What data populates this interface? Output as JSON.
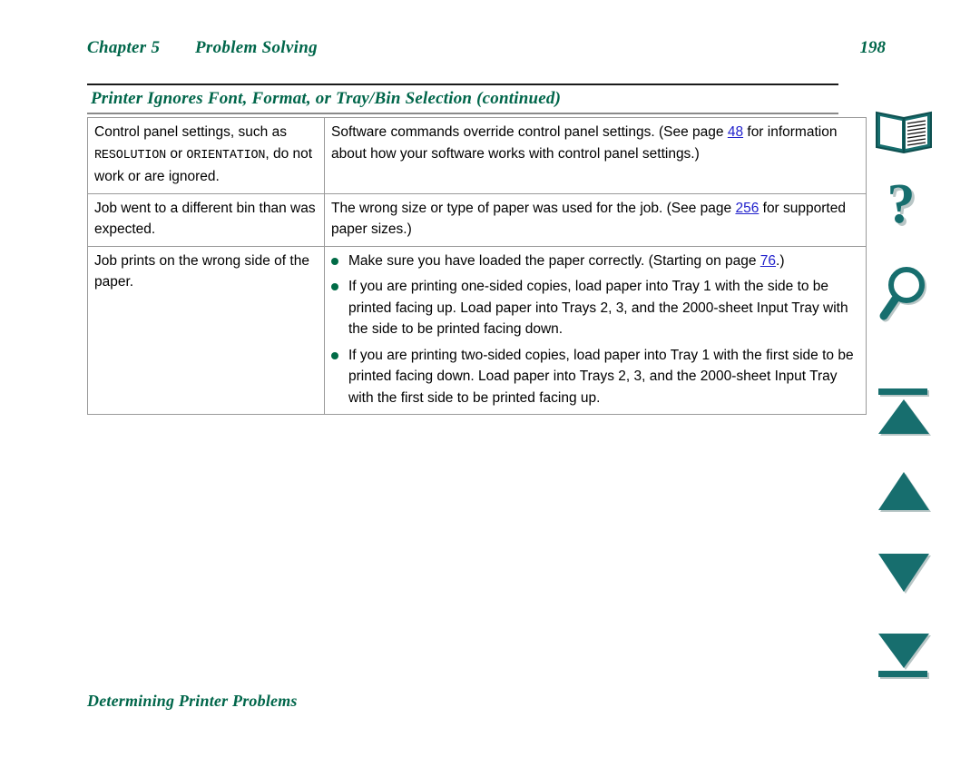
{
  "header": {
    "chapter": "Chapter 5",
    "section": "Problem Solving",
    "page_number": "198",
    "heading_color": "#00664a"
  },
  "table": {
    "title": "Printer Ignores Font, Format, or Tray/Bin Selection (continued)",
    "rows": [
      {
        "cause_prefix": "Control panel settings, such as ",
        "cause_mono_1": "RESOLUTION",
        "cause_mid": " or ",
        "cause_mono_2": "ORIENTATION",
        "cause_suffix": ", do not work or are ignored.",
        "solution_prefix": "Software commands override control panel settings. (See page ",
        "solution_link": "48",
        "solution_suffix": " for information about how your software works with control panel settings.)"
      },
      {
        "cause": "Job went to a different bin than was expected.",
        "solution_prefix": "The wrong size or type of paper was used for the job. (See page ",
        "solution_link": "256",
        "solution_suffix": " for supported paper sizes.)"
      },
      {
        "cause": "Job prints on the wrong side of the paper.",
        "bullets": [
          {
            "prefix": "Make sure you have loaded the paper correctly. (Starting on page ",
            "link": "76",
            "suffix": ".)"
          },
          {
            "text": "If you are printing one-sided copies, load paper into Tray 1 with the side to be printed facing up. Load paper into Trays 2, 3, and the 2000-sheet Input Tray with the side to be printed facing down."
          },
          {
            "text": "If you are printing two-sided copies, load paper into Tray 1 with the first side to be printed facing down. Load paper into Trays 2, 3, and the 2000-sheet Input Tray with the first side to be printed facing up."
          }
        ]
      }
    ],
    "bullet_color": "#006b46",
    "link_color": "#2222cc"
  },
  "footer": {
    "section_title": "Determining Printer Problems"
  },
  "nav": {
    "accent_color": "#176e6e",
    "items": [
      {
        "icon": "open-book-icon",
        "label": "Contents"
      },
      {
        "icon": "question-mark-icon",
        "label": "Help"
      },
      {
        "icon": "magnifying-glass-icon",
        "label": "Search"
      },
      {
        "icon": "first-page-icon",
        "label": "First Page"
      },
      {
        "icon": "previous-page-icon",
        "label": "Previous Page"
      },
      {
        "icon": "next-page-icon",
        "label": "Next Page"
      },
      {
        "icon": "last-page-icon",
        "label": "Last Page"
      }
    ]
  }
}
